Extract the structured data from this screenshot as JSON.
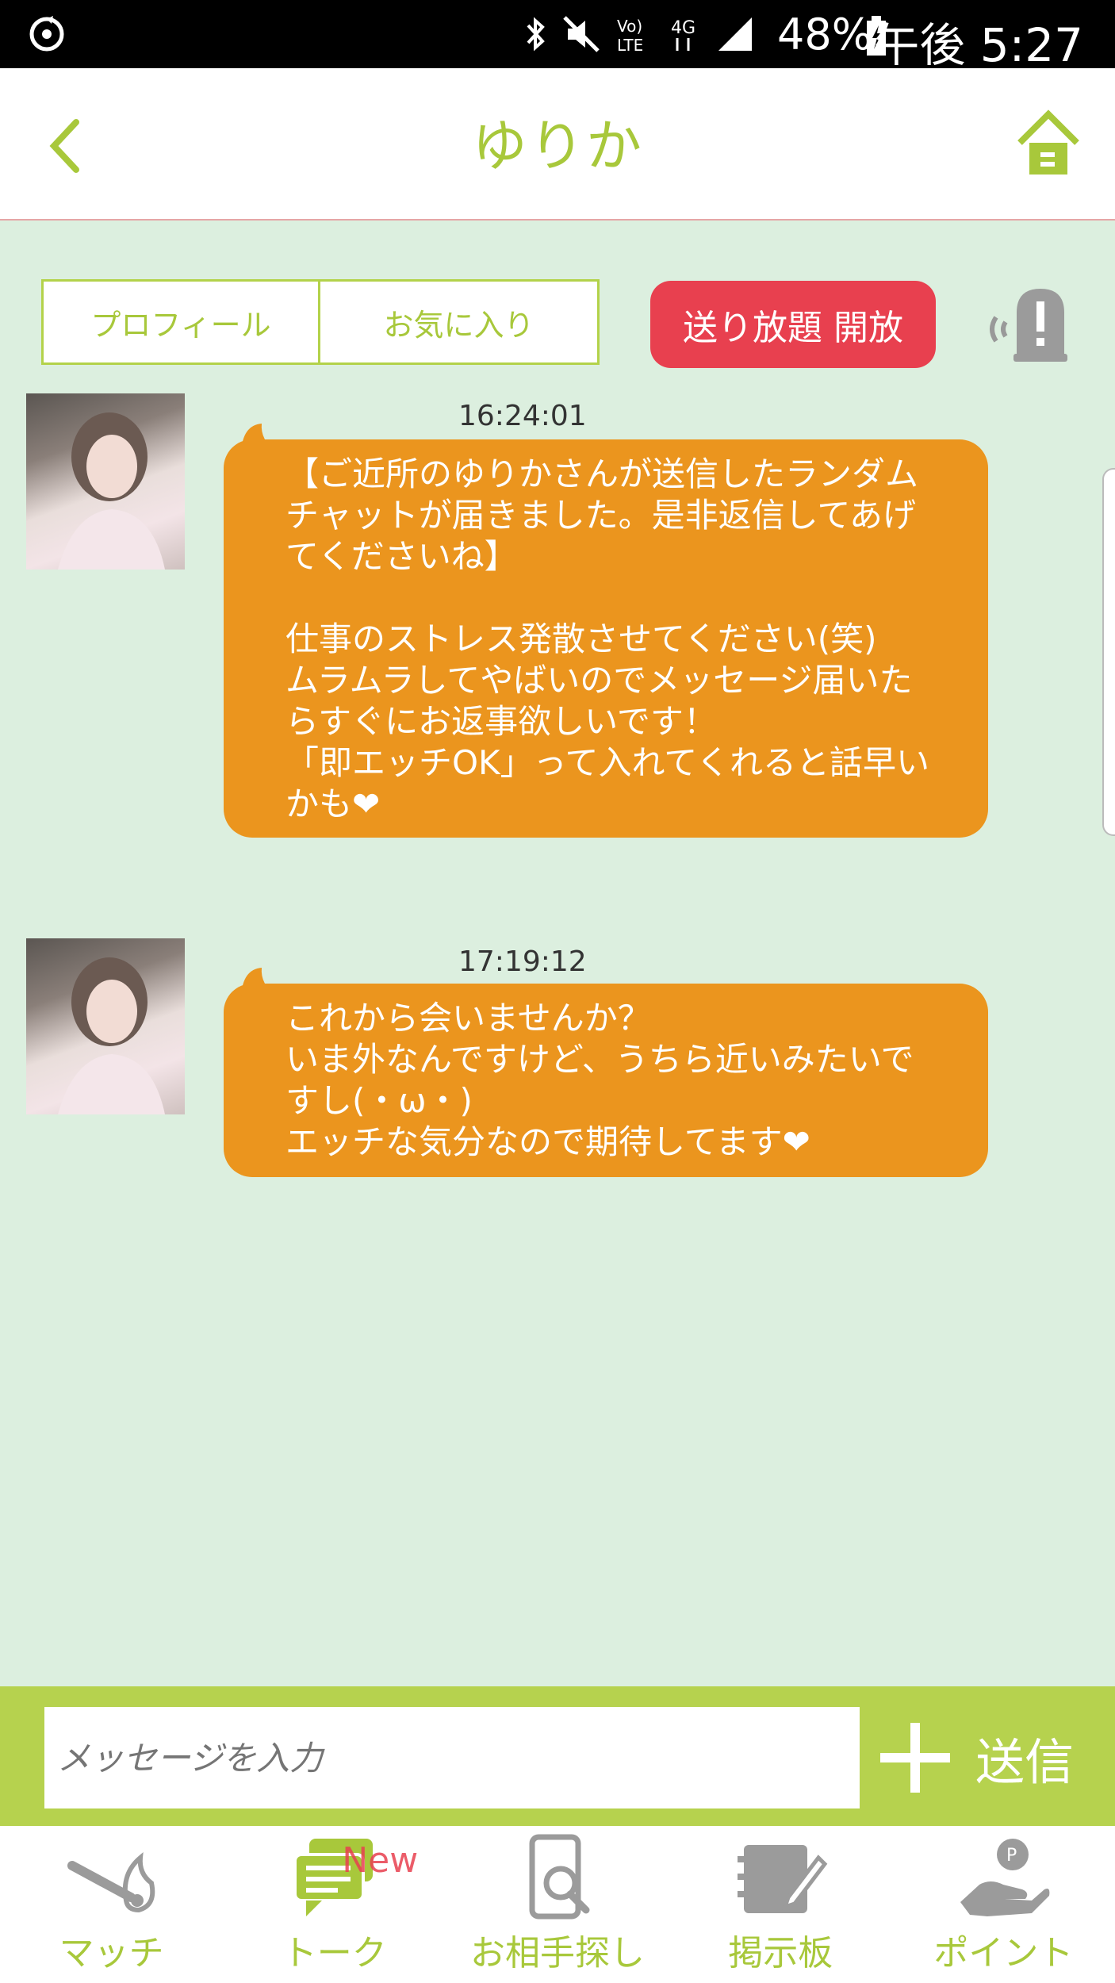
{
  "status_bar": {
    "battery": "48%",
    "time": "午後 5:27"
  },
  "header": {
    "title": "ゆりか"
  },
  "actions": {
    "profile_label": "プロフィール",
    "favorite_label": "お気に入り",
    "unlimited_label": "送り放題 開放"
  },
  "messages": [
    {
      "time": "16:24:01",
      "text": "【ご近所のゆりかさんが送信したランダムチャットが届きました。是非返信してあげてくださいね】\n\n仕事のストレス発散させてください(笑)\nムラムラしてやばいのでメッセージ届いたらすぐにお返事欲しいです！\n「即エッチOK」って入れてくれると話早いかも❤"
    },
    {
      "time": "17:19:12",
      "text": "これから会いませんか？\nいま外なんですけど、うちら近いみたいですし(・ω・)\nエッチな気分なので期待してます❤"
    }
  ],
  "input": {
    "placeholder": "メッセージを入力",
    "send_label": "送信"
  },
  "nav": {
    "match": "マッチ",
    "talk": "トーク",
    "talk_badge": "New",
    "search": "お相手探し",
    "board": "掲示板",
    "points": "ポイント"
  },
  "colors": {
    "accent": "#a8c83b",
    "bubble": "#eb951e",
    "alert": "#e8404f",
    "background": "#dcefdf"
  }
}
